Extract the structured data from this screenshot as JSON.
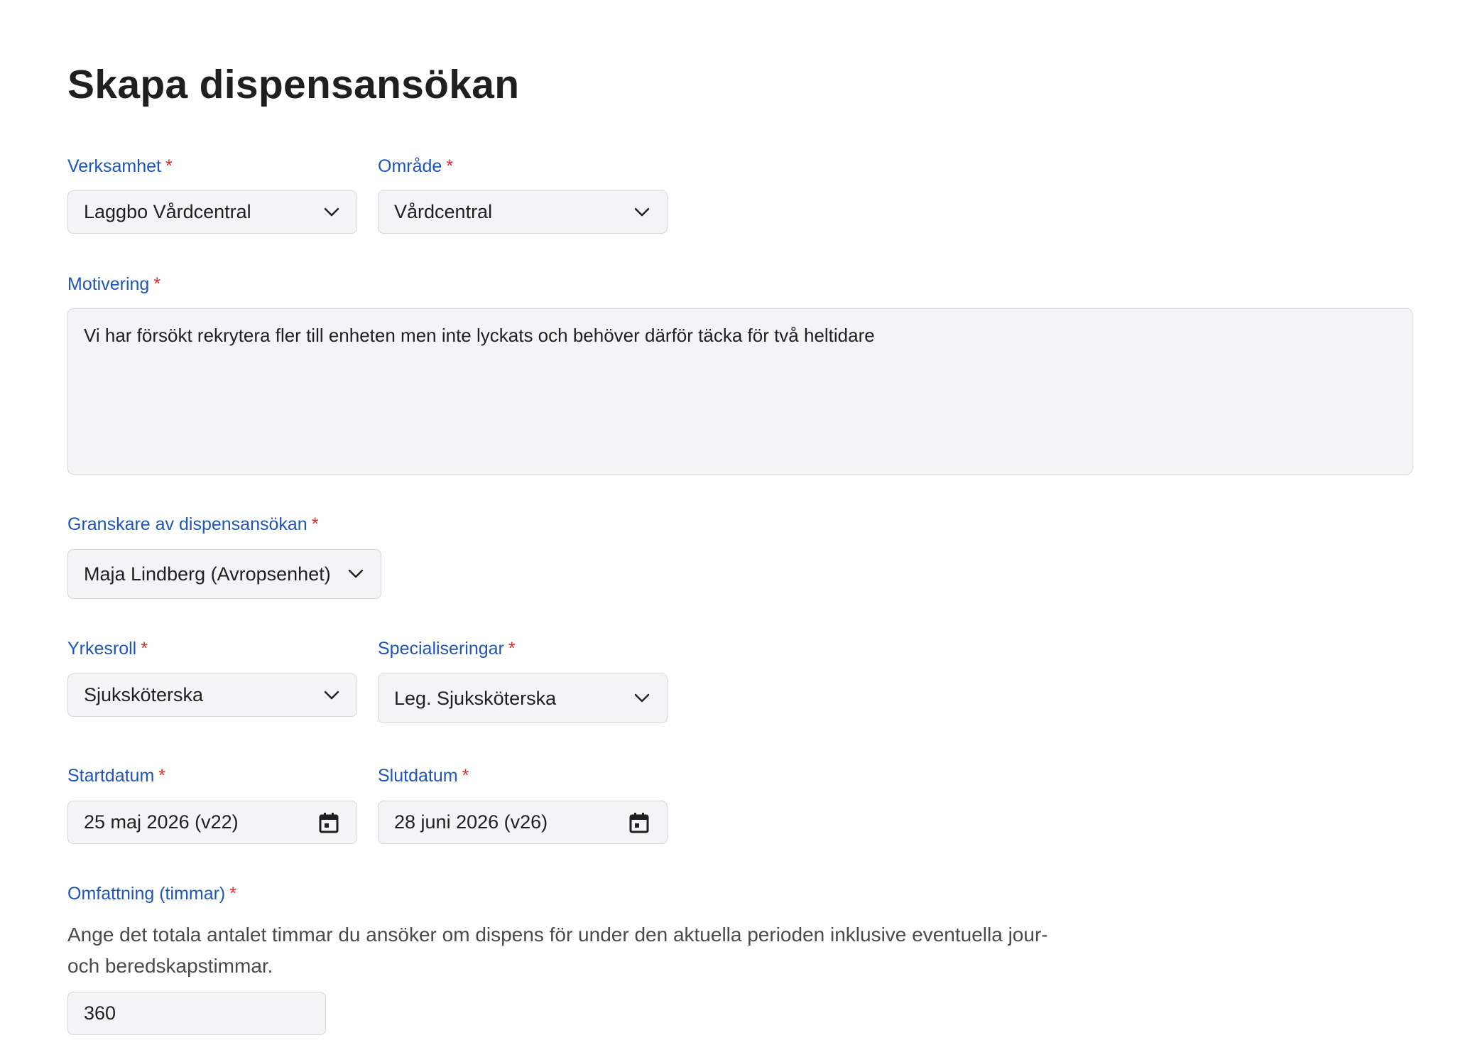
{
  "page": {
    "title": "Skapa dispensansökan",
    "required_marker": "*"
  },
  "form": {
    "verksamhet": {
      "label": "Verksamhet",
      "value": "Laggbo Vårdcentral"
    },
    "omrade": {
      "label": "Område",
      "value": "Vårdcentral"
    },
    "motivering": {
      "label": "Motivering",
      "value": "Vi har försökt rekrytera fler till enheten men inte lyckats och behöver därför täcka för två heltidare"
    },
    "granskare": {
      "label": "Granskare av dispensansökan",
      "value": "Maja Lindberg (Avropsenhet)"
    },
    "yrkesroll": {
      "label": "Yrkesroll",
      "value": "Sjuksköterska"
    },
    "specialiseringar": {
      "label": "Specialiseringar",
      "value": "Leg. Sjuksköterska"
    },
    "startdatum": {
      "label": "Startdatum",
      "value": "25 maj 2026 (v22)"
    },
    "slutdatum": {
      "label": "Slutdatum",
      "value": "28 juni 2026 (v26)"
    },
    "omfattning": {
      "label": "Omfattning (timmar)",
      "helper": "Ange det totala antalet timmar du ansöker om dispens för under den aktuella perioden inklusive eventuella jour- och beredskapstimmar.",
      "value": "360"
    }
  },
  "icons": {
    "select": "chevron-down-icon",
    "date": "calendar-icon"
  },
  "colors": {
    "label": "#2055b8",
    "required": "#d3322b",
    "field_bg": "#f4f4f6",
    "field_border": "#d8d8dc"
  }
}
